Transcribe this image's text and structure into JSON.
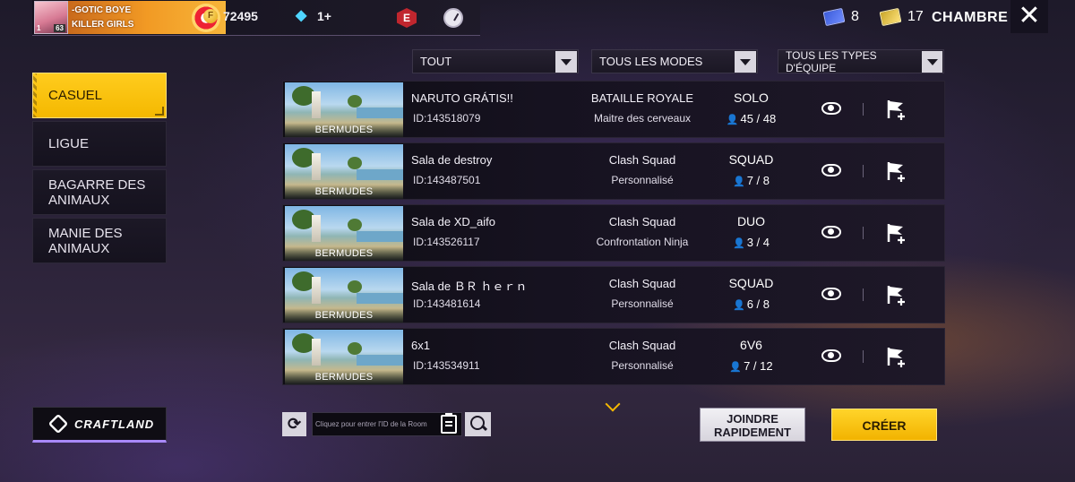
{
  "header": {
    "player_name_1": "-GOTIC BOYE",
    "player_name_2": "KILLER GIRLS",
    "level_left": "1",
    "level_right": "63",
    "gold": "72495",
    "diamonds": "1+",
    "blue_tickets": "8",
    "gold_tickets": "17",
    "title": "CHAMBRE",
    "close_label": "✕"
  },
  "sidebar": {
    "items": [
      {
        "label": "CASUEL"
      },
      {
        "label": "LIGUE"
      },
      {
        "label": "BAGARRE DES ANIMAUX"
      },
      {
        "label": "MANIE DES ANIMAUX"
      }
    ],
    "active_index": 0,
    "craftland_label": "CRAFTLAND"
  },
  "filters": {
    "scope": "TOUT",
    "modes": "TOUS LES MODES",
    "teams": "TOUS LES TYPES D'ÉQUIPE"
  },
  "rooms": [
    {
      "map": "BERMUDES",
      "name": "NARUTO GRÁTIS!!",
      "id": "ID:143518079",
      "mode": "BATAILLE ROYALE",
      "submode": "Maitre des cerveaux",
      "team": "SOLO",
      "players": "45 / 48"
    },
    {
      "map": "BERMUDES",
      "name": "Sala de destroy",
      "id": "ID:143487501",
      "mode": "Clash Squad",
      "submode": "Personnalisé",
      "team": "SQUAD",
      "players": "7 / 8"
    },
    {
      "map": "BERMUDES",
      "name": "Sala de XD_aifo",
      "id": "ID:143526117",
      "mode": "Clash Squad",
      "submode": "Confrontation Ninja",
      "team": "DUO",
      "players": "3 / 4"
    },
    {
      "map": "BERMUDES",
      "name": "Sala de ＢＲ ｈｅｒｎ",
      "id": "ID:143481614",
      "mode": "Clash Squad",
      "submode": "Personnalisé",
      "team": "SQUAD",
      "players": "6 / 8"
    },
    {
      "map": "BERMUDES",
      "name": "6x1",
      "id": "ID:143534911",
      "mode": "Clash Squad",
      "submode": "Personnalisé",
      "team": "6V6",
      "players": "7 / 12"
    }
  ],
  "bottom": {
    "room_input_placeholder": "Cliquez pour entrer l'ID de la Room",
    "join_line1": "JOINDRE",
    "join_line2": "RAPIDEMENT",
    "create_label": "CRÉER"
  },
  "colors": {
    "accent_yellow": "#f4b800",
    "panel_dark": "#15121e"
  }
}
